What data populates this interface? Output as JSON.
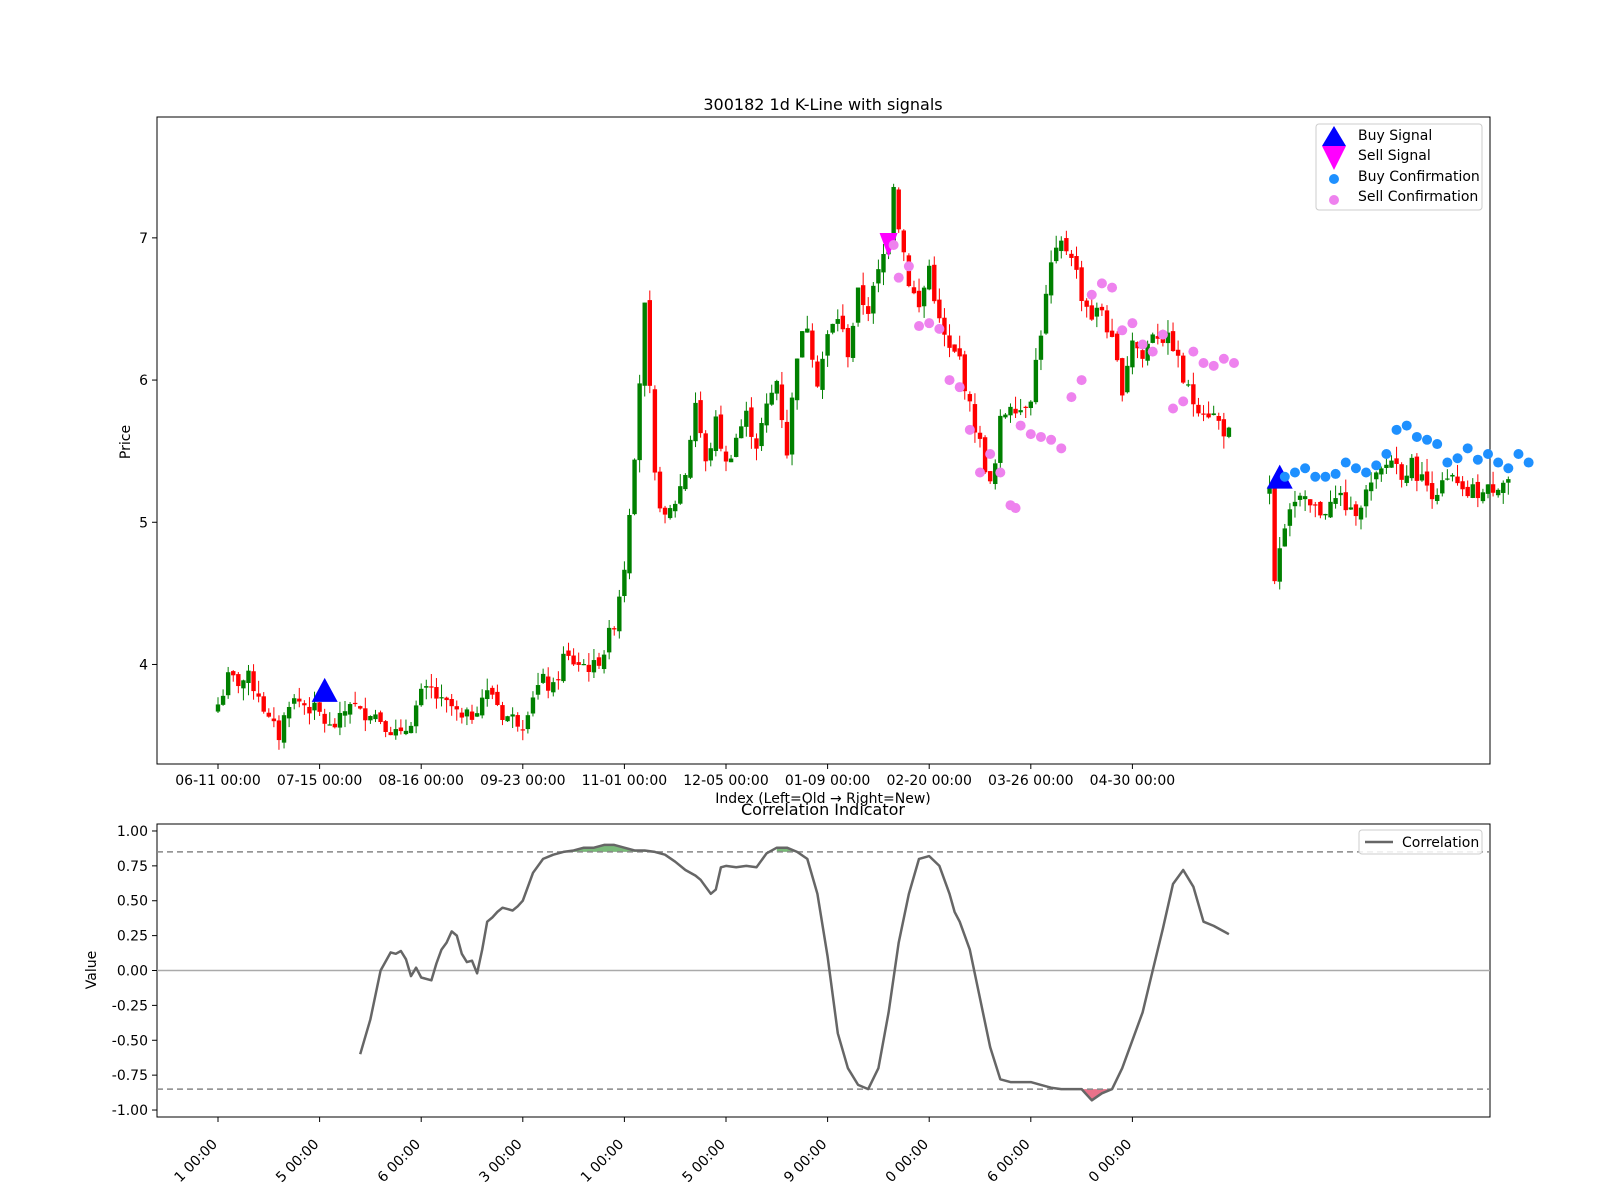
{
  "chart_data": [
    {
      "type": "candlestick",
      "title": "300182 1d K-Line with signals",
      "xlabel": "Index (Left=Old → Right=New)",
      "ylabel": "Price",
      "x_range": [
        -9,
        210
      ],
      "ylim": [
        3.3,
        7.85
      ],
      "yticks": [
        4,
        5,
        6,
        7
      ],
      "xticks": [
        {
          "index": 0,
          "label": "06-11 00:00"
        },
        {
          "index": 20,
          "label": "07-15 00:00"
        },
        {
          "index": 40,
          "label": "08-16 00:00"
        },
        {
          "index": 60,
          "label": "09-23 00:00"
        },
        {
          "index": 80,
          "label": "11-01 00:00"
        },
        {
          "index": 100,
          "label": "12-05 00:00"
        },
        {
          "index": 120,
          "label": "01-09 00:00"
        },
        {
          "index": 140,
          "label": "02-20 00:00"
        },
        {
          "index": 160,
          "label": "03-26 00:00"
        },
        {
          "index": 180,
          "label": "04-30 00:00"
        }
      ],
      "up_color": "#008000",
      "down_color": "#ff0000",
      "close_anchors": [
        [
          0,
          3.72
        ],
        [
          2,
          3.9
        ],
        [
          4,
          3.88
        ],
        [
          6,
          3.9
        ],
        [
          8,
          3.8
        ],
        [
          10,
          3.6
        ],
        [
          12,
          3.5
        ],
        [
          14,
          3.75
        ],
        [
          16,
          3.74
        ],
        [
          18,
          3.7
        ],
        [
          20,
          3.65
        ],
        [
          22,
          3.55
        ],
        [
          24,
          3.6
        ],
        [
          26,
          3.75
        ],
        [
          28,
          3.65
        ],
        [
          30,
          3.68
        ],
        [
          32,
          3.62
        ],
        [
          34,
          3.55
        ],
        [
          36,
          3.48
        ],
        [
          38,
          3.62
        ],
        [
          40,
          3.78
        ],
        [
          42,
          3.82
        ],
        [
          44,
          3.72
        ],
        [
          46,
          3.7
        ],
        [
          48,
          3.6
        ],
        [
          50,
          3.65
        ],
        [
          52,
          3.78
        ],
        [
          54,
          3.8
        ],
        [
          56,
          3.65
        ],
        [
          58,
          3.62
        ],
        [
          60,
          3.6
        ],
        [
          62,
          3.8
        ],
        [
          64,
          3.88
        ],
        [
          66,
          3.82
        ],
        [
          68,
          4.05
        ],
        [
          70,
          4.02
        ],
        [
          72,
          4.0
        ],
        [
          74,
          3.98
        ],
        [
          76,
          4.1
        ],
        [
          78,
          4.3
        ],
        [
          80,
          4.7
        ],
        [
          82,
          5.5
        ],
        [
          84,
          6.5
        ],
        [
          85,
          5.9
        ],
        [
          86,
          5.3
        ],
        [
          88,
          5.0
        ],
        [
          90,
          5.15
        ],
        [
          92,
          5.35
        ],
        [
          94,
          5.85
        ],
        [
          96,
          5.4
        ],
        [
          98,
          5.7
        ],
        [
          100,
          5.4
        ],
        [
          102,
          5.6
        ],
        [
          104,
          5.75
        ],
        [
          106,
          5.55
        ],
        [
          108,
          5.8
        ],
        [
          110,
          6.0
        ],
        [
          112,
          5.5
        ],
        [
          114,
          6.2
        ],
        [
          116,
          6.4
        ],
        [
          118,
          6.0
        ],
        [
          120,
          6.3
        ],
        [
          122,
          6.45
        ],
        [
          124,
          6.2
        ],
        [
          126,
          6.6
        ],
        [
          128,
          6.5
        ],
        [
          130,
          6.75
        ],
        [
          132,
          7.0
        ],
        [
          133,
          7.4
        ],
        [
          134,
          7.1
        ],
        [
          136,
          6.7
        ],
        [
          138,
          6.5
        ],
        [
          140,
          6.8
        ],
        [
          142,
          6.4
        ],
        [
          144,
          6.2
        ],
        [
          146,
          6.15
        ],
        [
          148,
          5.8
        ],
        [
          150,
          5.55
        ],
        [
          152,
          5.25
        ],
        [
          153,
          5.4
        ],
        [
          154,
          5.7
        ],
        [
          156,
          5.85
        ],
        [
          158,
          5.8
        ],
        [
          160,
          5.9
        ],
        [
          162,
          6.35
        ],
        [
          164,
          6.8
        ],
        [
          166,
          6.95
        ],
        [
          168,
          6.9
        ],
        [
          170,
          6.6
        ],
        [
          172,
          6.45
        ],
        [
          174,
          6.5
        ],
        [
          176,
          6.25
        ],
        [
          178,
          5.95
        ],
        [
          180,
          6.3
        ],
        [
          182,
          6.15
        ],
        [
          184,
          6.35
        ],
        [
          186,
          6.3
        ],
        [
          188,
          6.25
        ],
        [
          190,
          6.0
        ],
        [
          192,
          5.85
        ],
        [
          194,
          5.8
        ],
        [
          196,
          5.75
        ],
        [
          198,
          5.65
        ],
        [
          199,
          5.62
        ]
      ],
      "gap_range": [
        200,
        206
      ],
      "close_anchors_2": [
        [
          207,
          5.2
        ],
        [
          208,
          4.6
        ],
        [
          209,
          4.85
        ],
        [
          210,
          5.0
        ],
        [
          211,
          5.12
        ],
        [
          213,
          5.15
        ],
        [
          215,
          5.1
        ],
        [
          217,
          5.08
        ],
        [
          219,
          5.12
        ],
        [
          221,
          5.18
        ],
        [
          223,
          5.05
        ],
        [
          225,
          5.15
        ],
        [
          227,
          5.25
        ],
        [
          229,
          5.35
        ],
        [
          231,
          5.45
        ],
        [
          233,
          5.35
        ],
        [
          235,
          5.4
        ],
        [
          237,
          5.3
        ],
        [
          239,
          5.22
        ],
        [
          241,
          5.25
        ],
        [
          243,
          5.3
        ],
        [
          245,
          5.18
        ],
        [
          247,
          5.22
        ],
        [
          249,
          5.2
        ],
        [
          251,
          5.25
        ],
        [
          253,
          5.3
        ],
        [
          254,
          5.3
        ]
      ],
      "series": [
        {
          "name": "Buy Signal",
          "marker": "triangle-up",
          "color": "#0000ff",
          "points": [
            [
              21,
              3.8
            ],
            [
              209,
              5.3
            ]
          ]
        },
        {
          "name": "Sell Signal",
          "marker": "triangle-down",
          "color": "#ff00ff",
          "points": [
            [
              132,
              6.95
            ]
          ]
        },
        {
          "name": "Buy Confirmation",
          "marker": "circle",
          "color": "#1e90ff",
          "points": [
            [
              210,
              5.32
            ],
            [
              212,
              5.35
            ],
            [
              214,
              5.38
            ],
            [
              216,
              5.32
            ],
            [
              218,
              5.32
            ],
            [
              220,
              5.34
            ],
            [
              222,
              5.42
            ],
            [
              224,
              5.38
            ],
            [
              226,
              5.35
            ],
            [
              228,
              5.4
            ],
            [
              230,
              5.48
            ],
            [
              232,
              5.65
            ],
            [
              234,
              5.68
            ],
            [
              236,
              5.6
            ],
            [
              238,
              5.58
            ],
            [
              240,
              5.55
            ],
            [
              242,
              5.42
            ],
            [
              244,
              5.45
            ],
            [
              246,
              5.52
            ],
            [
              248,
              5.44
            ],
            [
              250,
              5.48
            ],
            [
              252,
              5.42
            ],
            [
              254,
              5.38
            ],
            [
              256,
              5.48
            ],
            [
              258,
              5.42
            ]
          ]
        },
        {
          "name": "Sell Confirmation",
          "marker": "circle",
          "color": "#ee82ee",
          "points": [
            [
              133,
              6.95
            ],
            [
              134,
              6.72
            ],
            [
              136,
              6.8
            ],
            [
              138,
              6.38
            ],
            [
              140,
              6.4
            ],
            [
              142,
              6.36
            ],
            [
              144,
              6.0
            ],
            [
              146,
              5.95
            ],
            [
              148,
              5.65
            ],
            [
              150,
              5.35
            ],
            [
              152,
              5.48
            ],
            [
              154,
              5.35
            ],
            [
              156,
              5.12
            ],
            [
              157,
              5.1
            ],
            [
              158,
              5.68
            ],
            [
              160,
              5.62
            ],
            [
              162,
              5.6
            ],
            [
              164,
              5.58
            ],
            [
              166,
              5.52
            ],
            [
              168,
              5.88
            ],
            [
              170,
              6.0
            ],
            [
              172,
              6.6
            ],
            [
              174,
              6.68
            ],
            [
              176,
              6.65
            ],
            [
              178,
              6.35
            ],
            [
              180,
              6.4
            ],
            [
              182,
              6.25
            ],
            [
              184,
              6.2
            ],
            [
              186,
              6.32
            ],
            [
              188,
              5.8
            ],
            [
              190,
              5.85
            ],
            [
              192,
              6.2
            ],
            [
              194,
              6.12
            ],
            [
              196,
              6.1
            ],
            [
              198,
              6.15
            ],
            [
              200,
              6.12
            ]
          ]
        }
      ],
      "legend_position": "top-right"
    },
    {
      "type": "line",
      "title": "Correlation Indicator",
      "ylabel": "Value",
      "ylim": [
        -1.05,
        1.05
      ],
      "yticks": [
        "1.00",
        "0.75",
        "0.50",
        "0.25",
        "0.00",
        "-0.25",
        "-0.50",
        "-0.75",
        "-1.00"
      ],
      "xtick_labels": [
        "1 00:00",
        "5 00:00",
        "6 00:00",
        "3 00:00",
        "1 00:00",
        "5 00:00",
        "9 00:00",
        "0 00:00",
        "6 00:00",
        "0 00:00"
      ],
      "thresholds": [
        0.85,
        -0.85
      ],
      "series": [
        {
          "name": "Correlation",
          "color": "#666666",
          "x": [
            28,
            30,
            32,
            34,
            35,
            36,
            37,
            38,
            39,
            40,
            42,
            43,
            44,
            45,
            46,
            47,
            48,
            49,
            50,
            51,
            52,
            53,
            54,
            55,
            56,
            57,
            58,
            59,
            60,
            62,
            64,
            66,
            68,
            70,
            72,
            74,
            76,
            78,
            80,
            82,
            84,
            86,
            88,
            90,
            92,
            94,
            95,
            96,
            97,
            98,
            99,
            100,
            102,
            104,
            106,
            108,
            110,
            112,
            114,
            116,
            118,
            120,
            122,
            124,
            126,
            128,
            130,
            132,
            134,
            136,
            138,
            140,
            142,
            144,
            145,
            146,
            148,
            150,
            152,
            154,
            156,
            158,
            160,
            162,
            164,
            166,
            168,
            170,
            172,
            174,
            176,
            178,
            180,
            182,
            184,
            186,
            188,
            190,
            192,
            194,
            196,
            198,
            199
          ],
          "values": [
            -0.6,
            -0.35,
            0.0,
            0.13,
            0.12,
            0.14,
            0.08,
            -0.04,
            0.02,
            -0.05,
            -0.07,
            0.05,
            0.15,
            0.2,
            0.28,
            0.25,
            0.12,
            0.06,
            0.07,
            -0.02,
            0.15,
            0.35,
            0.38,
            0.42,
            0.45,
            0.44,
            0.43,
            0.46,
            0.5,
            0.7,
            0.8,
            0.83,
            0.85,
            0.86,
            0.88,
            0.88,
            0.9,
            0.9,
            0.88,
            0.86,
            0.86,
            0.85,
            0.83,
            0.78,
            0.72,
            0.68,
            0.65,
            0.6,
            0.55,
            0.58,
            0.74,
            0.75,
            0.74,
            0.75,
            0.74,
            0.84,
            0.88,
            0.88,
            0.85,
            0.8,
            0.55,
            0.1,
            -0.45,
            -0.7,
            -0.82,
            -0.85,
            -0.7,
            -0.3,
            0.2,
            0.55,
            0.8,
            0.82,
            0.75,
            0.55,
            0.42,
            0.35,
            0.15,
            -0.2,
            -0.55,
            -0.78,
            -0.8,
            -0.8,
            -0.8,
            -0.82,
            -0.84,
            -0.85,
            -0.85,
            -0.85,
            -0.93,
            -0.88,
            -0.85,
            -0.7,
            -0.5,
            -0.3,
            0.0,
            0.3,
            0.62,
            0.72,
            0.6,
            0.35,
            0.32,
            0.28,
            0.26
          ]
        }
      ],
      "legend_position": "top-right"
    }
  ]
}
